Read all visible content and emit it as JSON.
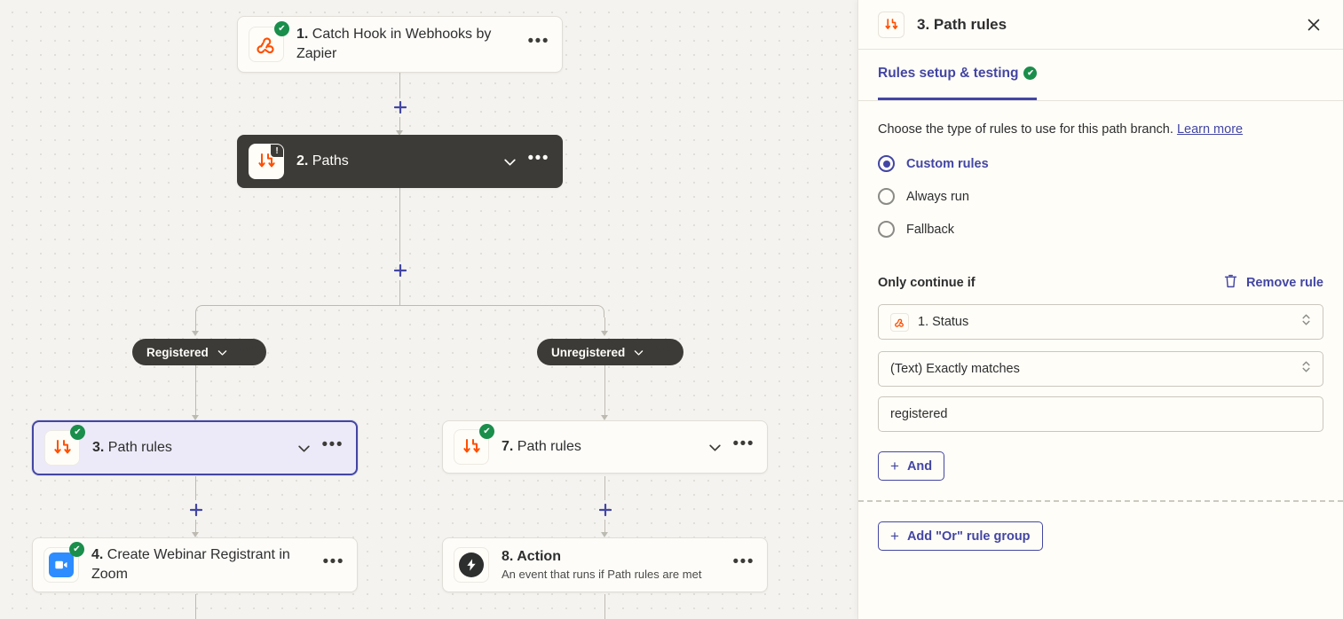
{
  "canvas": {
    "nodes": [
      {
        "id": "node-1",
        "step": "1.",
        "title": "Catch Hook in Webhooks by Zapier",
        "icon": "webhooks-icon",
        "status": "check"
      },
      {
        "id": "node-2",
        "step": "2.",
        "title": "Paths",
        "icon": "paths-icon",
        "status": "warning"
      },
      {
        "id": "node-3",
        "step": "3.",
        "title": "Path rules",
        "icon": "paths-icon",
        "status": "check"
      },
      {
        "id": "node-4",
        "step": "4.",
        "title": "Create Webinar Registrant in Zoom",
        "icon": "zoom-icon",
        "status": "check"
      },
      {
        "id": "node-7",
        "step": "7.",
        "title": "Path rules",
        "icon": "paths-icon",
        "status": "check"
      },
      {
        "id": "node-8",
        "step": "8.",
        "title": "Action",
        "subtitle": "An event that runs if Path rules are met",
        "icon": "bolt-icon",
        "status": "none"
      }
    ],
    "branches": [
      {
        "label": "Registered"
      },
      {
        "label": "Unregistered"
      }
    ],
    "add_step_label": "+"
  },
  "panel": {
    "title": "3. Path rules",
    "header_icon": "paths-icon",
    "close_label": "✕",
    "tabs": [
      {
        "label": "Rules setup & testing",
        "status": "check",
        "active": true
      }
    ],
    "intro": {
      "text": "Choose the type of rules to use for this path branch.",
      "link_label": "Learn more"
    },
    "rule_type": {
      "options": [
        {
          "label": "Custom rules",
          "checked": true
        },
        {
          "label": "Always run",
          "checked": false
        },
        {
          "label": "Fallback",
          "checked": false
        }
      ]
    },
    "rule_section": {
      "title": "Only continue if",
      "remove_label": "Remove rule",
      "remove_icon": "trash-icon",
      "field_select": {
        "value": "1. Status",
        "icon": "webhooks-icon"
      },
      "operator_select": {
        "value": "(Text) Exactly matches"
      },
      "value_input": {
        "value": "registered",
        "placeholder": "Enter text or insert data"
      },
      "and_button": "And",
      "or_group_button": "Add \"Or\" rule group"
    }
  },
  "colors": {
    "accent_indigo": "#4346a3",
    "brand_orange": "#ff4f00",
    "success_green": "#1a8e4b",
    "canvas_bg": "#f4f3ef",
    "panel_bg": "#fffdf8",
    "node_dark": "#3d3b38",
    "zoom_blue": "#2d8cff"
  }
}
